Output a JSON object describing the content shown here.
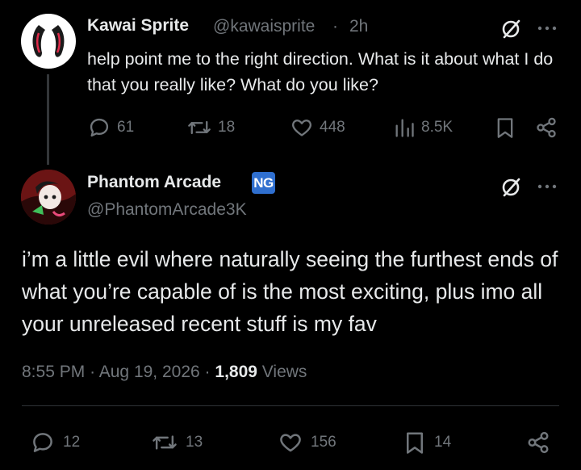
{
  "parent_tweet": {
    "display_name": "Kawai Sprite",
    "handle": "@kawaisprite",
    "separator": "·",
    "age": "2h",
    "text": "help point me to the right direction. What is it about what I do that you really like? What do you like?",
    "actions": {
      "replies": "61",
      "retweets": "18",
      "likes": "448",
      "views": "8.5K"
    }
  },
  "reply_tweet": {
    "display_name": "Phantom Arcade",
    "badge": "NG",
    "handle": "@PhantomArcade3K",
    "text": "i’m a little evil where naturally seeing the furthest ends of what you’re capable of is the most exciting, plus imo all your unreleased recent stuff is my fav",
    "time": "8:55 PM",
    "date": "Aug 19, 2026",
    "meta_separator": "·",
    "views_count": "1,809",
    "views_label": "Views",
    "actions": {
      "replies": "12",
      "retweets": "13",
      "likes": "156",
      "bookmarks": "14"
    }
  },
  "colors": {
    "background": "#000000",
    "primary_text": "#e7e9ea",
    "secondary_text": "#71767b",
    "badge": "#2f6fcf"
  }
}
